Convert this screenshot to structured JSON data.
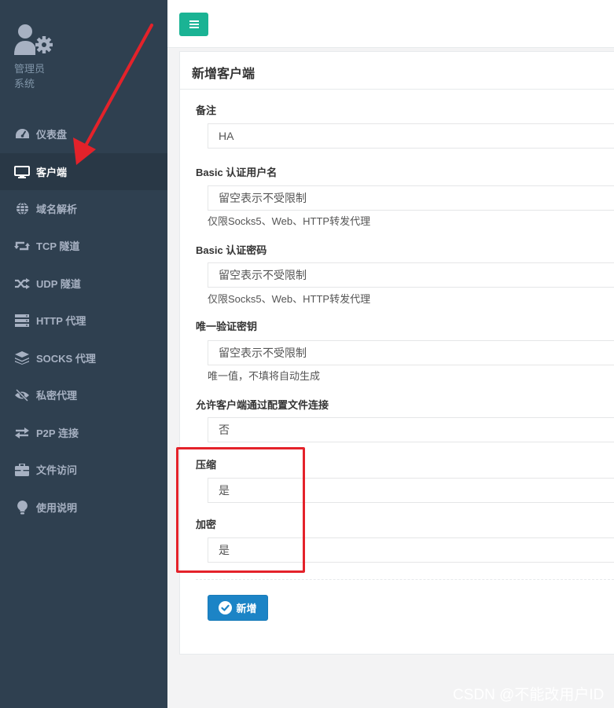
{
  "sidebar": {
    "profile": {
      "name": "管理员",
      "role": "系统",
      "avatar_icon": "user-gear-icon"
    },
    "items": [
      {
        "label": "仪表盘",
        "icon": "dashboard-icon"
      },
      {
        "label": "客户端",
        "icon": "monitor-icon",
        "active": true
      },
      {
        "label": "域名解析",
        "icon": "globe-icon"
      },
      {
        "label": "TCP 隧道",
        "icon": "retweet-icon"
      },
      {
        "label": "UDP 隧道",
        "icon": "random-icon"
      },
      {
        "label": "HTTP 代理",
        "icon": "server-icon"
      },
      {
        "label": "SOCKS 代理",
        "icon": "layers-icon"
      },
      {
        "label": "私密代理",
        "icon": "eye-slash-icon"
      },
      {
        "label": "P2P 连接",
        "icon": "exchange-icon"
      },
      {
        "label": "文件访问",
        "icon": "briefcase-icon"
      },
      {
        "label": "使用说明",
        "icon": "lightbulb-icon"
      }
    ]
  },
  "topbar": {
    "menu_icon": "hamburger-icon",
    "accent": "#1ab394"
  },
  "form": {
    "title": "新增客户端",
    "remark": {
      "label": "备注",
      "value": "HA"
    },
    "basic_user": {
      "label": "Basic 认证用户名",
      "placeholder": "留空表示不受限制",
      "hint": "仅限Socks5、Web、HTTP转发代理"
    },
    "basic_pass": {
      "label": "Basic 认证密码",
      "placeholder": "留空表示不受限制",
      "hint": "仅限Socks5、Web、HTTP转发代理"
    },
    "vkey": {
      "label": "唯一验证密钥",
      "placeholder": "留空表示不受限制",
      "hint": "唯一值，不填将自动生成"
    },
    "config_conn": {
      "label": "允许客户端通过配置文件连接",
      "value": "否"
    },
    "compress": {
      "label": "压缩",
      "value": "是"
    },
    "crypt": {
      "label": "加密",
      "value": "是"
    },
    "submit": {
      "label": "新增",
      "icon": "check-circle-icon",
      "color": "#1c84c6"
    }
  },
  "annotation": {
    "color": "#e4222a"
  },
  "watermark": "CSDN @不能改用户ID"
}
